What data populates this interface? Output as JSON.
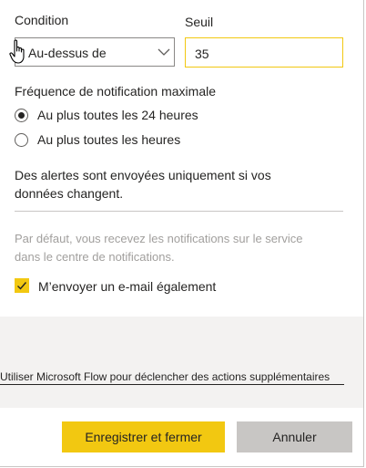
{
  "condition": {
    "label": "Condition",
    "selected": "Au-dessus de"
  },
  "threshold": {
    "label": "Seuil",
    "value": "35"
  },
  "frequency": {
    "label": "Fréquence de notification maximale",
    "options": [
      {
        "label": "Au plus toutes les 24 heures",
        "selected": true
      },
      {
        "label": "Au plus toutes les heures",
        "selected": false
      }
    ]
  },
  "alert_info": {
    "line1": "Des alertes sont envoyées uniquement si vos",
    "line2": "données changent."
  },
  "default_info": {
    "line1": "Par défaut, vous recevez les notifications sur le service",
    "line2": "dans le centre de notifications."
  },
  "email_option": {
    "label": "M’envoyer un e-mail également",
    "checked": true
  },
  "flow_link": "Utiliser Microsoft Flow pour déclencher des actions supplémentaires",
  "buttons": {
    "save": "Enregistrer et fermer",
    "cancel": "Annuler"
  },
  "colors": {
    "accent": "#f2c811",
    "muted_text": "#a19f9d",
    "secondary_button": "#c8c6c4"
  }
}
